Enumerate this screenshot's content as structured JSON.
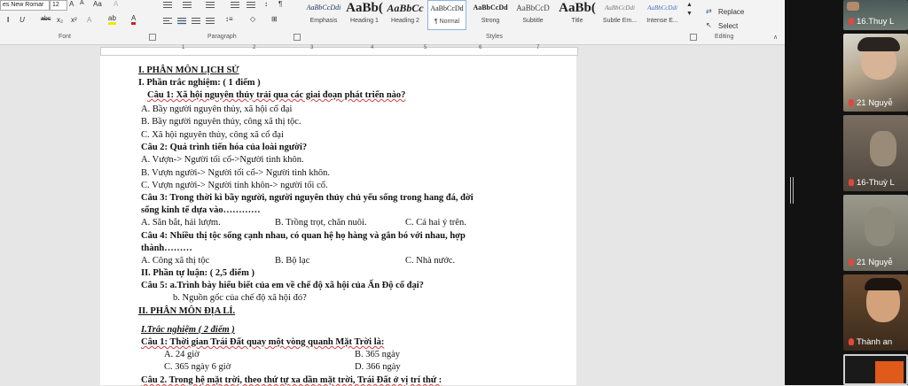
{
  "ribbon": {
    "font_name": "es New Romar",
    "font_size": "12",
    "group_font": "Font",
    "group_paragraph": "Paragraph",
    "group_styles": "Styles",
    "group_editing": "Editing",
    "styles": [
      {
        "sample": "AaBbCcDdi",
        "name": "Emphasis"
      },
      {
        "sample": "AaBb(",
        "name": "Heading 1"
      },
      {
        "sample": "AaBbCc",
        "name": "Heading 2"
      },
      {
        "sample": "AaBbCcDd",
        "name": "¶ Normal"
      },
      {
        "sample": "AaBbCcDd",
        "name": "Strong"
      },
      {
        "sample": "AaBbCcD",
        "name": "Subtitle"
      },
      {
        "sample": "AaBb(",
        "name": "Title"
      },
      {
        "sample": "AaBbCcDdi",
        "name": "Subtle Em..."
      },
      {
        "sample": "AaBbCcDdi",
        "name": "Intense E..."
      }
    ],
    "replace_label": "Replace",
    "select_label": "Select"
  },
  "ruler": {
    "numbers": [
      "1",
      "2",
      "3",
      "4",
      "5",
      "6",
      "7"
    ]
  },
  "document": {
    "lines": [
      "I. PHÂN MÔN LỊCH SỬ",
      "I. Phần trắc nghiệm: ( 1 điểm )",
      "Câu 1: Xã hội nguyên thủy trải qua các giai đoạn phát triển nào?",
      "A. Bầy người nguyên thủy, xã hội cổ đại",
      "B. Bầy người nguyên thủy, công xã thị tộc.",
      "C. Xã hội nguyên thủy, công xã cổ đại",
      "Câu 2: Quá trình tiến hóa của loài người?",
      "A. Vượn-> Người tối cổ->Người tinh khôn.",
      "B. Vượn người-> Người tối cổ-> Người tinh khôn.",
      "C. Vượn người-> Người tinh khôn-> người tối cổ.",
      "Câu 3: Trong thời kì bầy người, người nguyên thủy chủ yếu sống trong hang đá, đời",
      "sống kinh tế dựa vào…………",
      "A. Săn bắt, hái lượm.",
      "B. Trồng trọt, chăn nuôi.",
      "C. Cả hai ý trên.",
      "Câu 4: Nhiều thị tộc sống cạnh nhau, có quan hệ họ hàng và gắn bó với nhau, hợp",
      "thành………",
      "A. Công xã thị tộc",
      "B. Bộ lạc",
      "C. Nhà nước.",
      "II. Phần tự luận: ( 2,5 điểm )",
      "Câu 5: a.Trình bày hiểu biết của em về chế độ xã hội của Ấn Độ cổ đại?",
      "b. Nguồn gốc của chế độ xã hội đó?",
      "II. PHÂN MÔN ĐỊA LÍ.",
      "I.Trắc nghiệm ( 2 điểm )",
      "Câu 1: Thời gian Trái Đất quay một vòng quanh Mặt Trời là:",
      "A. 24 giờ",
      "B. 365 ngày",
      "C. 365 ngày 6 giờ",
      "D. 366 ngày",
      "Câu 2. Trong hệ mặt trời, theo thứ tự xa dần mặt trời, Trái Đất ở vị trí thứ :"
    ]
  },
  "participants": [
    {
      "name": "16.Thuy L"
    },
    {
      "name": "21 Nguyễ"
    },
    {
      "name": "16-Thuỳ L"
    },
    {
      "name": "21 Nguyễ"
    },
    {
      "name": "Thành an"
    }
  ],
  "colors": {
    "mic_muted": "#e0473c",
    "panel_bg": "#121212",
    "active_border": "#e05a1a"
  }
}
